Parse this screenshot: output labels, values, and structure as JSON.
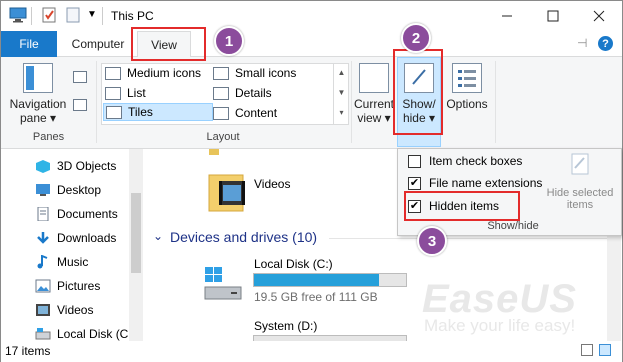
{
  "window": {
    "title": "This PC"
  },
  "ribbon_tabs": {
    "file": "File",
    "computer": "Computer",
    "view": "View"
  },
  "panes": {
    "navigation_pane_line1": "Navigation",
    "navigation_pane_line2": "pane",
    "group_label": "Panes"
  },
  "layout": {
    "group_label": "Layout",
    "items": [
      {
        "label": "Medium icons"
      },
      {
        "label": "Small icons"
      },
      {
        "label": "List"
      },
      {
        "label": "Details"
      },
      {
        "label": "Tiles"
      },
      {
        "label": "Content"
      }
    ],
    "selected": "Tiles"
  },
  "current_view": {
    "line1": "Current",
    "line2": "view"
  },
  "show_hide": {
    "line1": "Show/",
    "line2": "hide",
    "group_label": "Show/hide",
    "options": [
      {
        "label": "Item check boxes",
        "checked": false
      },
      {
        "label": "File name extensions",
        "checked": true
      },
      {
        "label": "Hidden items",
        "checked": true
      }
    ],
    "hide_selected_line1": "Hide selected",
    "hide_selected_line2": "items"
  },
  "options": {
    "label": "Options"
  },
  "nav_items": [
    {
      "label": "3D Objects",
      "icon": "3d-objects-icon"
    },
    {
      "label": "Desktop",
      "icon": "desktop-icon"
    },
    {
      "label": "Documents",
      "icon": "documents-icon"
    },
    {
      "label": "Downloads",
      "icon": "downloads-icon"
    },
    {
      "label": "Music",
      "icon": "music-icon"
    },
    {
      "label": "Pictures",
      "icon": "pictures-icon"
    },
    {
      "label": "Videos",
      "icon": "videos-icon"
    },
    {
      "label": "Local Disk (C:)",
      "icon": "drive-icon"
    }
  ],
  "content": {
    "videos_folder": "Videos",
    "devices_header": "Devices and drives (10)",
    "drives": [
      {
        "name": "Local Disk (C:)",
        "free_text": "19.5 GB free of 111 GB",
        "used_fraction": 0.82
      },
      {
        "name": "System (D:)"
      }
    ]
  },
  "status": {
    "items_count": "17 items"
  },
  "callouts": [
    "1",
    "2",
    "3"
  ],
  "watermark": {
    "brand": "EaseUS",
    "tagline": "Make your life easy!"
  },
  "colors": {
    "accent": "#1979ca",
    "callout": "#8b4c9c",
    "highlight": "#e32b2b",
    "selection": "#cce8ff"
  }
}
